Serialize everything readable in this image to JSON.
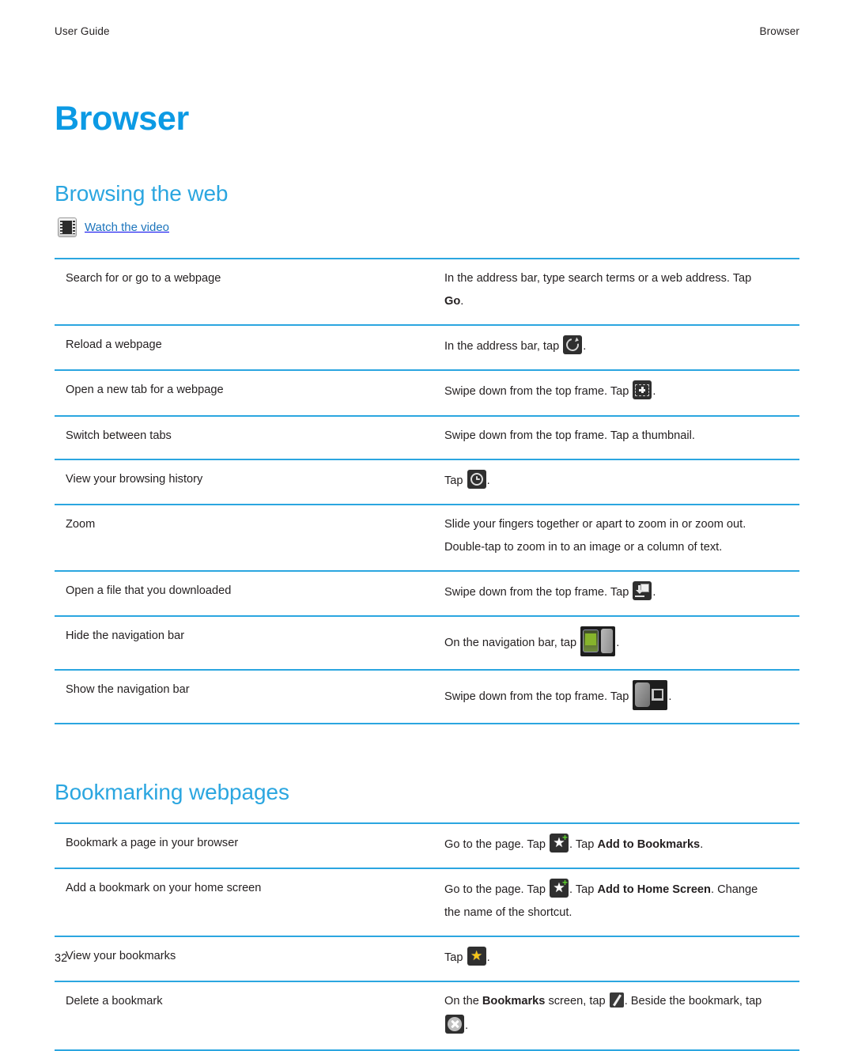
{
  "header": {
    "left": "User Guide",
    "right": "Browser"
  },
  "doc": {
    "title": "Browser",
    "page_number": "32"
  },
  "sections": [
    {
      "title": "Browsing the web",
      "video_link": {
        "label": "Watch the video",
        "icon": "film-strip-icon"
      },
      "rows": [
        {
          "task": "Search for or go to a webpage",
          "lines": [
            [
              {
                "t": "text",
                "v": "In the address bar, type search terms or a web address. Tap"
              }
            ],
            [
              {
                "t": "bold",
                "v": "Go"
              },
              {
                "t": "text",
                "v": "."
              }
            ]
          ]
        },
        {
          "task": "Reload a webpage",
          "lines": [
            [
              {
                "t": "text",
                "v": "In the address bar, tap"
              },
              {
                "t": "icon",
                "v": "reload-icon"
              },
              {
                "t": "text",
                "v": "."
              }
            ]
          ]
        },
        {
          "task": "Open a new tab for a webpage",
          "lines": [
            [
              {
                "t": "text",
                "v": "Swipe down from the top frame. Tap"
              },
              {
                "t": "icon",
                "v": "new-tab-icon"
              },
              {
                "t": "text",
                "v": "."
              }
            ]
          ]
        },
        {
          "task": "Switch between tabs",
          "lines": [
            [
              {
                "t": "text",
                "v": "Swipe down from the top frame. Tap a thumbnail."
              }
            ]
          ]
        },
        {
          "task": "View your browsing history",
          "lines": [
            [
              {
                "t": "text",
                "v": "Tap"
              },
              {
                "t": "icon",
                "v": "history-clock-icon"
              },
              {
                "t": "text",
                "v": "."
              }
            ]
          ]
        },
        {
          "task": "Zoom",
          "lines": [
            [
              {
                "t": "text",
                "v": "Slide your fingers together or apart to zoom in or zoom out."
              }
            ],
            [
              {
                "t": "text",
                "v": "Double-tap to zoom in to an image or a column of text."
              }
            ]
          ]
        },
        {
          "task": "Open a file that you downloaded",
          "lines": [
            [
              {
                "t": "text",
                "v": "Swipe down from the top frame. Tap"
              },
              {
                "t": "icon",
                "v": "downloads-icon"
              },
              {
                "t": "text",
                "v": "."
              }
            ]
          ]
        },
        {
          "task": "Hide the navigation bar",
          "lines": [
            [
              {
                "t": "text",
                "v": "On the navigation bar, tap"
              },
              {
                "t": "icon",
                "v": "hide-navigation-bar-icon"
              },
              {
                "t": "text",
                "v": "."
              }
            ]
          ]
        },
        {
          "task": "Show the navigation bar",
          "lines": [
            [
              {
                "t": "text",
                "v": "Swipe down from the top frame. Tap"
              },
              {
                "t": "icon",
                "v": "show-navigation-bar-icon"
              },
              {
                "t": "text",
                "v": "."
              }
            ]
          ]
        }
      ]
    },
    {
      "title": "Bookmarking webpages",
      "rows": [
        {
          "task": "Bookmark a page in your browser",
          "lines": [
            [
              {
                "t": "text",
                "v": "Go to the page. Tap"
              },
              {
                "t": "icon",
                "v": "add-bookmark-star-icon"
              },
              {
                "t": "text",
                "v": ". Tap"
              },
              {
                "t": "bold",
                "v": "Add to Bookmarks"
              },
              {
                "t": "text",
                "v": "."
              }
            ]
          ]
        },
        {
          "task": "Add a bookmark on your home screen",
          "lines": [
            [
              {
                "t": "text",
                "v": "Go to the page. Tap"
              },
              {
                "t": "icon",
                "v": "add-bookmark-star-icon"
              },
              {
                "t": "text",
                "v": ". Tap"
              },
              {
                "t": "bold",
                "v": "Add to Home Screen"
              },
              {
                "t": "text",
                "v": ". Change"
              }
            ],
            [
              {
                "t": "text",
                "v": "the name of the shortcut."
              }
            ]
          ]
        },
        {
          "task": "View your bookmarks",
          "lines": [
            [
              {
                "t": "text",
                "v": "Tap"
              },
              {
                "t": "icon",
                "v": "bookmarks-star-icon"
              },
              {
                "t": "text",
                "v": "."
              }
            ]
          ]
        },
        {
          "task": "Delete a bookmark",
          "lines": [
            [
              {
                "t": "text",
                "v": "On the"
              },
              {
                "t": "bold",
                "v": "Bookmarks"
              },
              {
                "t": "text",
                "v": "screen, tap"
              },
              {
                "t": "icon",
                "v": "edit-pencil-icon"
              },
              {
                "t": "text",
                "v": ". Beside the bookmark, tap"
              }
            ],
            [
              {
                "t": "icon",
                "v": "delete-x-icon"
              },
              {
                "t": "text",
                "v": "."
              }
            ]
          ]
        }
      ]
    }
  ],
  "colors": {
    "title_blue": "#0c9ae4",
    "heading_blue": "#2ba6e0",
    "link_blue": "#1d75bc",
    "rule_blue": "#2ba6e0",
    "body_text": "#231f20"
  }
}
